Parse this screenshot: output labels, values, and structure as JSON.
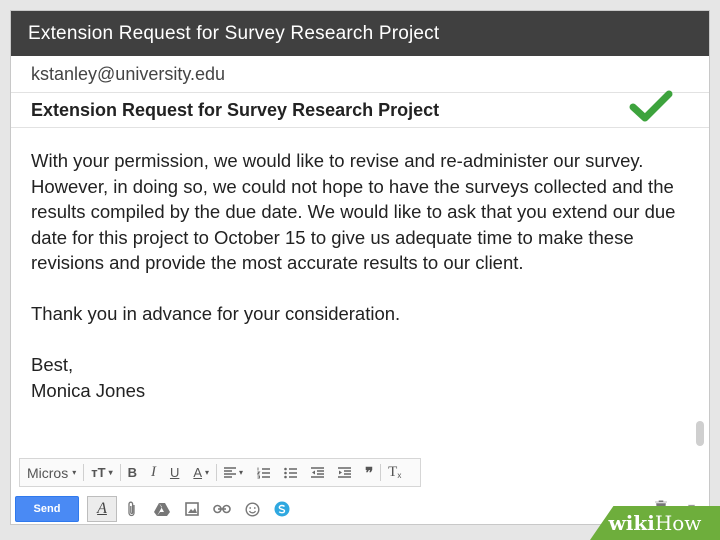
{
  "window": {
    "title": "Extension Request for Survey Research Project"
  },
  "compose": {
    "to": "kstanley@university.edu",
    "subject": "Extension Request for Survey Research Project",
    "body": [
      "With your permission, we would like to revise and re-administer our survey. However, in doing so, we could not hope to have the surveys collected and the results compiled by the due date. We would like to ask that you extend our due date for this project to October 15 to give us adequate time to make these revisions and provide the most accurate results to our client.",
      "Thank you in advance for your consideration."
    ],
    "closing": "Best,",
    "signature": "Monica Jones"
  },
  "format_bar": {
    "font_label": "Micros",
    "size_glyph": "ᴛT",
    "bold": "B",
    "italic": "I",
    "underline": "U",
    "text_color": "A",
    "quote": "❞",
    "clear": "T",
    "icons": [
      "font-select",
      "text-size-icon",
      "bold-icon",
      "italic-icon",
      "underline-icon",
      "text-color-icon",
      "align-icon",
      "numbered-list-icon",
      "bulleted-list-icon",
      "indent-less-icon",
      "indent-more-icon",
      "quote-icon",
      "remove-formatting-icon"
    ]
  },
  "toolbar": {
    "send_label": "Send",
    "format_glyph": "A",
    "icons": [
      "formatting-icon",
      "attach-icon",
      "drive-icon",
      "photo-icon",
      "link-icon",
      "emoji-icon",
      "hangouts-icon",
      "trash-icon",
      "more-icon"
    ]
  },
  "colors": {
    "titlebar": "#404040",
    "send": "#4a8af4",
    "check": "#3da33d",
    "watermark": "#6eae3c"
  },
  "watermark": {
    "wiki": "wiki",
    "how": "How"
  }
}
